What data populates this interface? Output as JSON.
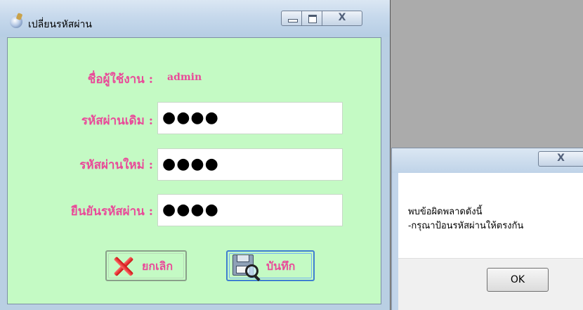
{
  "window": {
    "title": "เปลี่ยนรหัสผ่าน",
    "minimize_icon": "minimize-icon",
    "maximize_icon": "maximize-icon",
    "close_glyph": "X"
  },
  "form": {
    "username_label": "ชื่อผู้ใช้งาน :",
    "username_value": "admin",
    "old_password_label": "รหัสผ่านเดิม :",
    "old_password_value": "●●●●",
    "new_password_label": "รหัสผ่านใหม่ :",
    "new_password_value": "●●●●",
    "confirm_password_label": "ยืนยันรหัสผ่าน :",
    "confirm_password_value": "●●●●"
  },
  "buttons": {
    "cancel_label": "ยกเลิก",
    "cancel_icon": "x-mark-icon",
    "save_label": "บันทึก",
    "save_icon": "floppy-disk-icon"
  },
  "dialog": {
    "close_glyph": "X",
    "message_line1": "พบข้อผิดพลาดดังนี้",
    "message_line2": "-กรุณาป้อนรหัสผ่านให้ตรงกัน",
    "ok_label": "OK"
  },
  "colors": {
    "label_pink": "#e94a99",
    "form_background": "#c4fac4",
    "titlebar_blue": "#c7d9ec"
  }
}
